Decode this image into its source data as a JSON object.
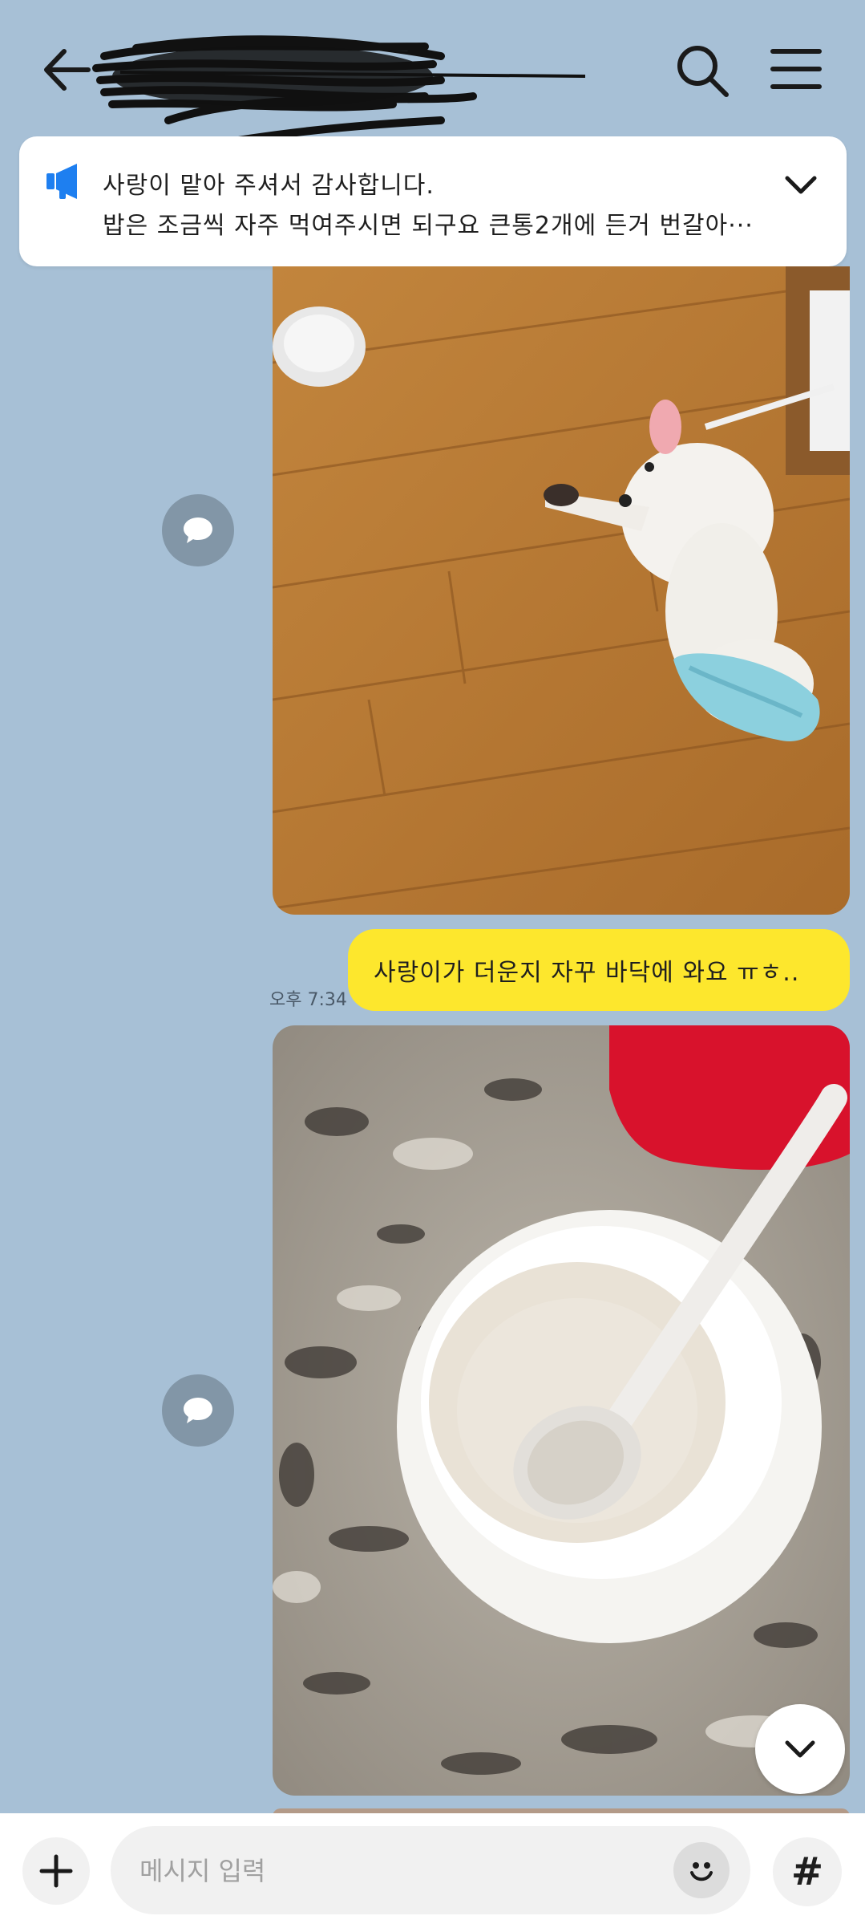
{
  "header": {
    "title_redacted": true,
    "icons": [
      "back-arrow-icon",
      "search-icon",
      "hamburger-menu-icon"
    ]
  },
  "notice": {
    "icon": "megaphone-icon",
    "line1": "사랑이 맡아 주셔서 감사합니다.",
    "line2": "밥은 조금씩 자주 먹여주시면 되구요 큰통2개에 든거 번갈아···",
    "expand_icon": "chevron-down-icon"
  },
  "messages": [
    {
      "type": "photo",
      "description_icon": "share-icon"
    },
    {
      "type": "text",
      "text": "사랑이가 더운지 자꾸 바닥에 와요 ㅠㅎ..",
      "time": "오후 7:34"
    },
    {
      "type": "photo",
      "description_icon": "share-icon"
    }
  ],
  "input": {
    "placeholder": "메시지 입력",
    "plus_icon": "plus-icon",
    "emoji_icon": "emoji-icon",
    "hash_label": "#"
  },
  "colors": {
    "background": "#a7c0d6",
    "my_bubble": "#fde72d",
    "notice_icon": "#1e7ff0"
  }
}
